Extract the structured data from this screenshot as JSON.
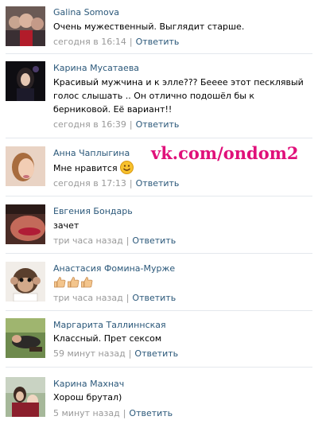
{
  "watermark": "vk.com/ondom2",
  "comments": [
    {
      "author": "Galina Somova",
      "text": "Очень мужественный. Выглядит старше.",
      "time": "сегодня в 16:14",
      "reply": "Ответить"
    },
    {
      "author": "Карина Мусатаева",
      "text": "Красивый мужчина и к элле??? Бееее этот песклявый голос слышать .. Он отлично подошёл бы к берниковой. Её вариант!!",
      "time": "сегодня в 16:39",
      "reply": "Ответить"
    },
    {
      "author": "Анна Чаплыгина",
      "text": "Мне нравится",
      "time": "сегодня в 17:13",
      "reply": "Ответить"
    },
    {
      "author": "Евгения Бондарь",
      "text": "зачет",
      "time": "три часа назад",
      "reply": "Ответить"
    },
    {
      "author": "Анастасия Фомина-Мурже",
      "text": "",
      "time": "три часа назад",
      "reply": "Ответить"
    },
    {
      "author": "Маргарита Таллиннская",
      "text": "Классный. Прет сексом",
      "time": "59 минут назад",
      "reply": "Ответить"
    },
    {
      "author": "Карина Махнач",
      "text": "Хорош брутал)",
      "time": "5 минут назад",
      "reply": "Ответить"
    }
  ],
  "icons": {
    "smile": "smile-emoji-icon",
    "thumbs": "thumbs-up-icon"
  },
  "colors": {
    "link": "#2b587a",
    "meta": "#999999",
    "watermark": "#e0107a",
    "divider": "#e4e8ed"
  }
}
